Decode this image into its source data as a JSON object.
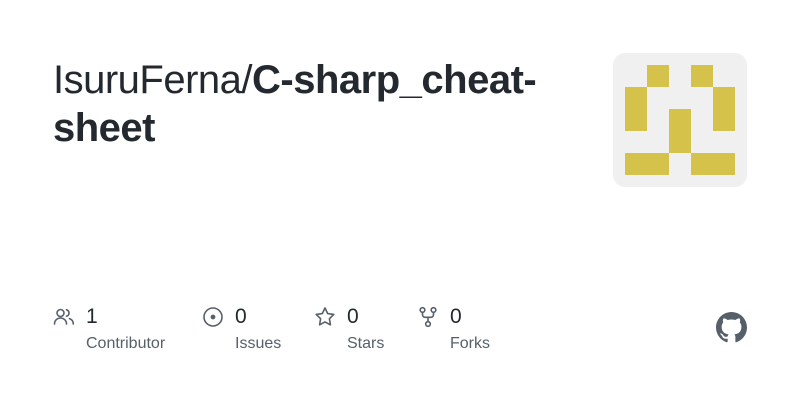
{
  "repo": {
    "owner_prefix": "IsuruFerna/",
    "name": "C-sharp_cheat-sheet"
  },
  "avatar": {
    "icon": "identicon",
    "color": "#d4c24a",
    "background": "#f0f0f0"
  },
  "stats": [
    {
      "icon": "people-icon",
      "count": "1",
      "label": "Contributor"
    },
    {
      "icon": "issue-icon",
      "count": "0",
      "label": "Issues"
    },
    {
      "icon": "star-icon",
      "count": "0",
      "label": "Stars"
    },
    {
      "icon": "fork-icon",
      "count": "0",
      "label": "Forks"
    }
  ],
  "brand": {
    "icon": "github-logo-icon",
    "color": "#57606a"
  }
}
